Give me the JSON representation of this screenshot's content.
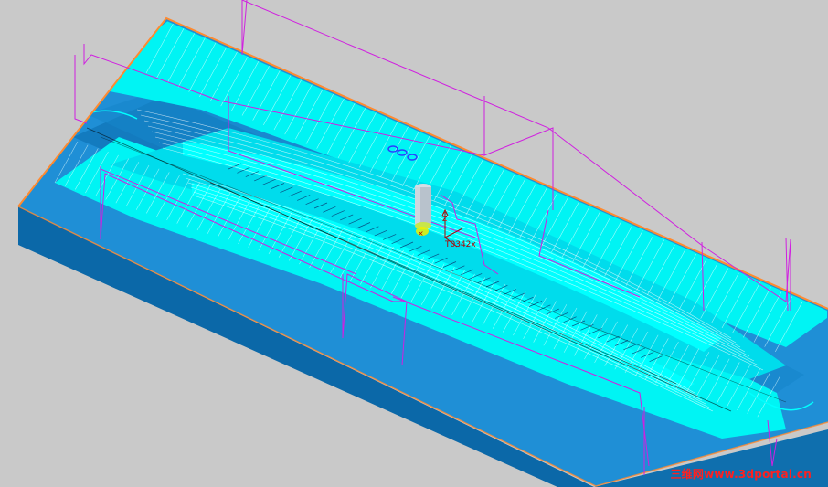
{
  "viewport": {
    "background": "#c9c9c9",
    "tool_label": "T0342x",
    "axis_label": "Z",
    "watermark": "三维网www.3dportal.cn"
  },
  "colors": {
    "block_top": "#1f8fd6",
    "block_side_front": "#0f6fae",
    "block_side_left": "#1a82c8",
    "toolpath": "#00ffff",
    "rapid_move": "#d020e0",
    "edge_highlight": "#ff8a30",
    "tool": "#b8c2cc",
    "tool_tip": "#f0f000"
  }
}
